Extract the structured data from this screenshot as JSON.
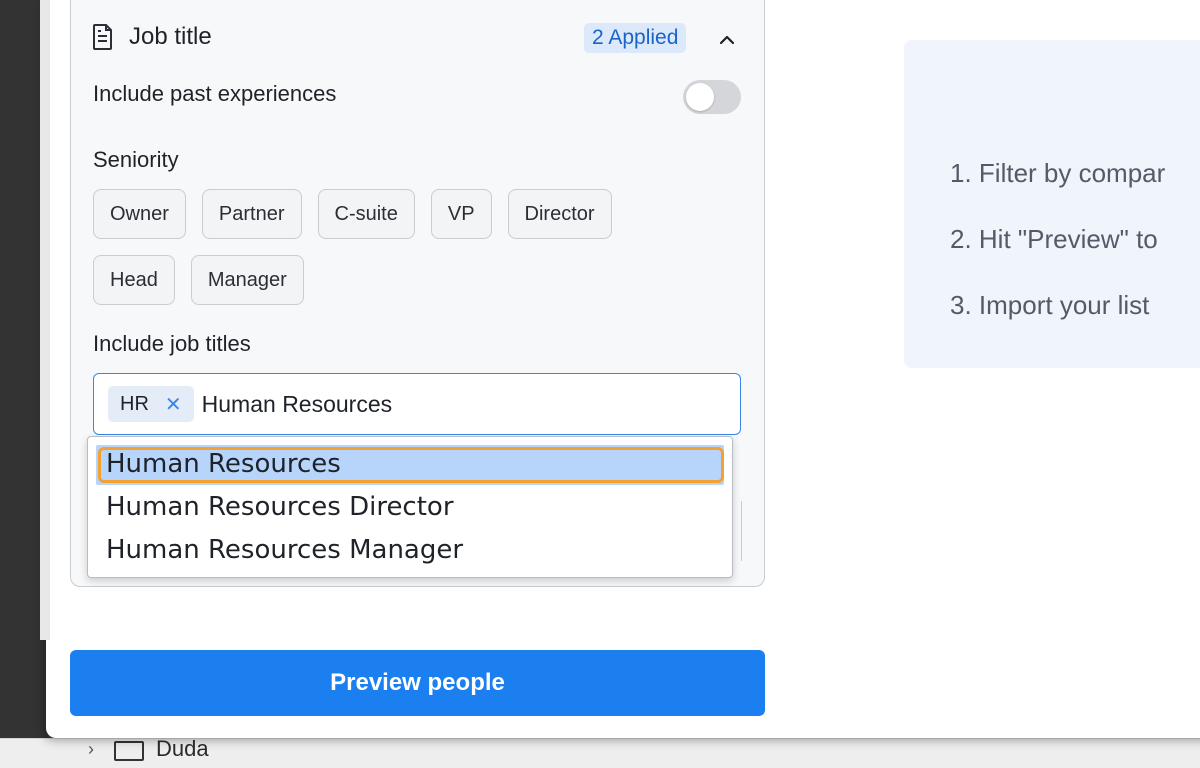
{
  "panel": {
    "title": "Job title",
    "applied": "2 Applied",
    "past_experiences_label": "Include past experiences",
    "past_experiences_on": false,
    "seniority_label": "Seniority",
    "seniority_options": [
      "Owner",
      "Partner",
      "C-suite",
      "VP",
      "Director",
      "Head",
      "Manager"
    ],
    "include_titles_label": "Include job titles",
    "job_input": {
      "tags": [
        "HR"
      ],
      "typed_value": "Human Resources"
    }
  },
  "dropdown": {
    "options": [
      "Human Resources",
      "Human Resources Director",
      "Human Resources Manager"
    ],
    "selected_index": 0
  },
  "preview_button": "Preview people",
  "info": {
    "steps": [
      "1. Filter by compar",
      "2. Hit \"Preview\" to",
      "3. Import your list"
    ]
  },
  "background": {
    "folder_label": "Duda"
  },
  "colors": {
    "accent": "#1b7ff0",
    "selection_ring": "#f4a133",
    "badge_bg": "#dbe9fb"
  }
}
